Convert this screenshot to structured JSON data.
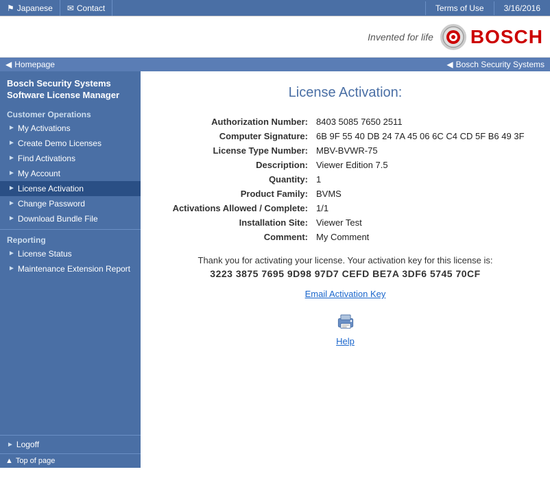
{
  "topbar": {
    "japanese_label": "Japanese",
    "contact_label": "Contact",
    "terms_label": "Terms of Use",
    "date": "3/16/2016"
  },
  "logobar": {
    "tagline": "Invented for life",
    "brand": "BOSCH"
  },
  "breadcrumb": {
    "homepage": "Homepage",
    "bosch_security": "Bosch Security Systems"
  },
  "sidebar": {
    "title_line1": "Bosch Security Systems",
    "title_line2": "Software License Manager",
    "customer_ops_label": "Customer Operations",
    "items": [
      {
        "label": "My Activations",
        "name": "my-activations"
      },
      {
        "label": "Create Demo Licenses",
        "name": "create-demo-licenses"
      },
      {
        "label": "Find Activations",
        "name": "find-activations"
      },
      {
        "label": "My Account",
        "name": "my-account"
      },
      {
        "label": "License Activation",
        "name": "license-activation",
        "active": true
      },
      {
        "label": "Change Password",
        "name": "change-password"
      },
      {
        "label": "Download Bundle File",
        "name": "download-bundle-file"
      }
    ],
    "reporting_label": "Reporting",
    "reporting_items": [
      {
        "label": "License Status",
        "name": "license-status"
      },
      {
        "label": "Maintenance Extension Report",
        "name": "maintenance-extension-report"
      }
    ],
    "logoff_label": "Logoff",
    "top_of_page_label": "Top of page"
  },
  "content": {
    "title": "License Activation:",
    "fields": [
      {
        "label": "Authorization Number:",
        "value": "8403 5085 7650 2511"
      },
      {
        "label": "Computer Signature:",
        "value": "6B 9F 55 40 DB 24 7A 45 06 6C C4 CD 5F B6 49 3F"
      },
      {
        "label": "License Type Number:",
        "value": "MBV-BVWR-75"
      },
      {
        "label": "Description:",
        "value": "Viewer Edition 7.5"
      },
      {
        "label": "Quantity:",
        "value": "1"
      },
      {
        "label": "Product Family:",
        "value": "BVMS"
      },
      {
        "label": "Activations Allowed / Complete:",
        "value": "1/1"
      },
      {
        "label": "Installation Site:",
        "value": "Viewer Test"
      },
      {
        "label": "Comment:",
        "value": "My Comment"
      }
    ],
    "thank_you_msg": "Thank you for activating your license. Your activation key for this license is:",
    "activation_key": "3223 3875 7695 9D98 97D7 CEFD BE7A 3DF6 5745 70CF",
    "email_link": "Email Activation Key",
    "help_label": "Help"
  }
}
